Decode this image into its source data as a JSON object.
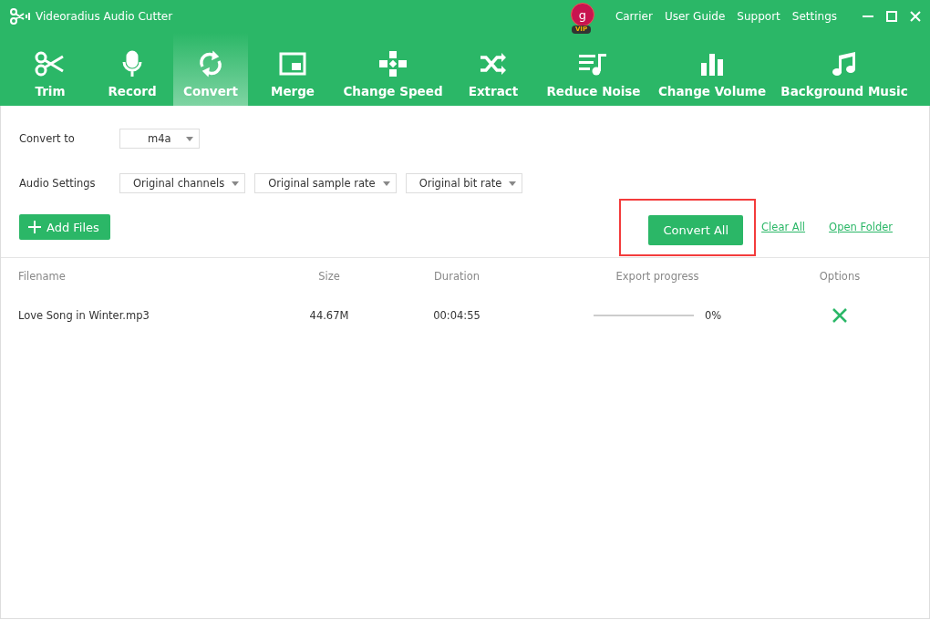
{
  "window": {
    "title": "Videoradius Audio Cutter",
    "vip_badge": "VIP",
    "avatar_letter": "g",
    "links": [
      "Carrier",
      "User Guide",
      "Support",
      "Settings"
    ]
  },
  "tabs": [
    {
      "label": "Trim",
      "selected": false
    },
    {
      "label": "Record",
      "selected": false
    },
    {
      "label": "Convert",
      "selected": true
    },
    {
      "label": "Merge",
      "selected": false
    },
    {
      "label": "Change Speed",
      "selected": false
    },
    {
      "label": "Extract",
      "selected": false
    },
    {
      "label": "Reduce Noise",
      "selected": false
    },
    {
      "label": "Change Volume",
      "selected": false
    },
    {
      "label": "Background Music",
      "selected": false
    }
  ],
  "convert_to": {
    "label": "Convert to",
    "value": "m4a"
  },
  "audio_settings": {
    "label": "Audio Settings",
    "selects": [
      "Original channels",
      "Original sample rate",
      "Original bit rate"
    ]
  },
  "add_files": {
    "label": "Add Files"
  },
  "convert_all": {
    "label": "Convert All",
    "highlighted": true
  },
  "links": [
    "Clear All",
    "Open Folder"
  ],
  "table": {
    "columns": [
      "Filename",
      "Size",
      "Duration",
      "Export progress",
      "Options"
    ],
    "rows": [
      {
        "filename": "Love Song in Winter.mp3",
        "size": "44.67M",
        "duration": "00:04:55",
        "level": 0,
        "progress": "0%"
      }
    ]
  }
}
